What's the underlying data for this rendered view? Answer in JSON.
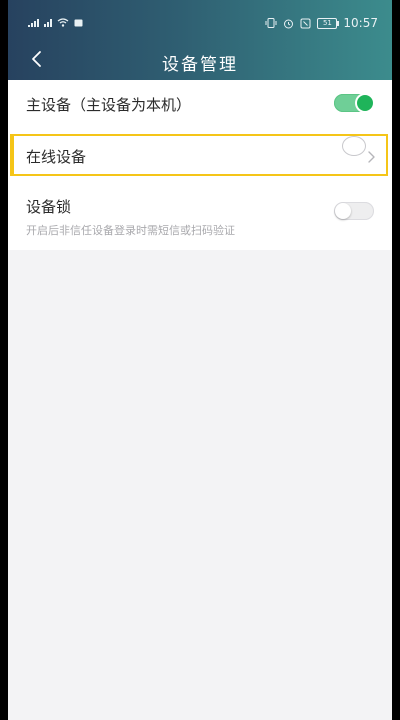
{
  "status_bar": {
    "time": "10:57",
    "battery_label": "51"
  },
  "header": {
    "title": "设备管理",
    "back_icon": "chevron-left-icon"
  },
  "settings": {
    "main_device": {
      "label": "主设备（主设备为本机）",
      "enabled": true
    },
    "online_devices": {
      "label": "在线设备",
      "icon": "chevron-right-icon"
    },
    "device_lock": {
      "label": "设备锁",
      "description": "开启后非信任设备登录时需短信或扫码验证",
      "enabled": false
    }
  },
  "colors": {
    "toggle_on": "#1fb45a",
    "highlight": "#f5c518",
    "header_start": "#27425f",
    "header_end": "#3c8c8d"
  }
}
